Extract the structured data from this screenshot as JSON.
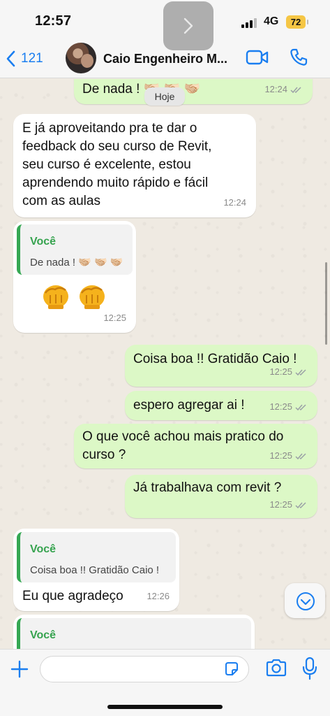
{
  "status_bar": {
    "time": "12:57",
    "network": "4G",
    "battery": "72"
  },
  "header": {
    "back_count": "121",
    "contact_name": "Caio Engenheiro M..."
  },
  "chat": {
    "date_chip": "Hoje",
    "messages": [
      {
        "id": "m0",
        "direction": "out",
        "text": "De nada ! 🫱🏼‍🫲🏻 🫱🏼‍🫲🏻 🫱🏼‍🫲🏻",
        "time": "12:24"
      },
      {
        "id": "m1",
        "direction": "in",
        "text": "E já aproveitando pra te dar o\nfeedback do seu curso de Revit,\nseu curso é excelente, estou\naprendendo muito rápido e fácil\ncom as aulas",
        "time": "12:24"
      },
      {
        "id": "m2",
        "direction": "in",
        "quote_author": "Você",
        "quote_text": "De nada ! 🫱🏼‍🫲🏻 🫱🏼‍🫲🏻 🫱🏼‍🫲🏻",
        "text": "👊👊",
        "time": "12:25"
      },
      {
        "id": "m3",
        "direction": "out",
        "text": "Coisa boa !! Gratidão Caio !",
        "time": "12:25"
      },
      {
        "id": "m4",
        "direction": "out",
        "text": "espero agregar ai !",
        "time": "12:25"
      },
      {
        "id": "m5",
        "direction": "out",
        "text": "O que você achou mais pratico do\ncurso ?",
        "time": "12:25"
      },
      {
        "id": "m6",
        "direction": "out",
        "text": "Já trabalhava com revit ?",
        "time": "12:25"
      },
      {
        "id": "m7",
        "direction": "in",
        "quote_author": "Você",
        "quote_text": "Coisa boa !! Gratidão Caio !",
        "text": "Eu que agradeço",
        "time": "12:26"
      },
      {
        "id": "m8",
        "direction": "in",
        "quote_author": "Você",
        "quote_text": ""
      }
    ]
  },
  "composer": {
    "placeholder": "",
    "value": ""
  },
  "icons": {
    "back": "chevron-left-icon",
    "video": "video-camera-icon",
    "call": "phone-icon",
    "plus": "plus-icon",
    "sticker": "sticker-icon",
    "camera": "camera-icon",
    "mic": "microphone-icon",
    "scroll": "chevron-down-icon",
    "overlay": "chevron-right-icon"
  },
  "colors": {
    "accent": "#1a7ef0",
    "outgoing_bubble": "#dcf8c6",
    "incoming_bubble": "#ffffff",
    "quote_author": "#36a34f",
    "battery": "#f5c645"
  }
}
